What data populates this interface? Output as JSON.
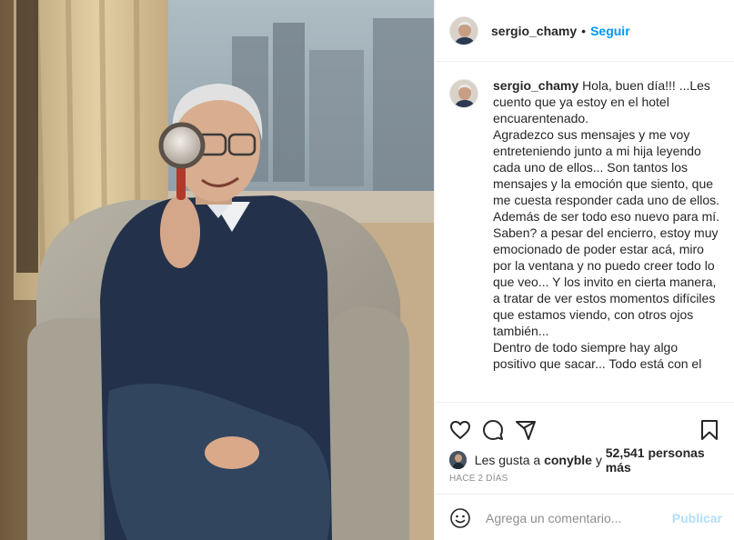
{
  "post": {
    "image_alt": "",
    "author": {
      "username": "sergio_chamy",
      "avatar_icon": "profile-avatar"
    },
    "header": {
      "dot": "•",
      "follow_label": "Seguir"
    },
    "caption": {
      "username": "sergio_chamy",
      "text": "Hola, buen día!!! ...Les cuento que ya estoy en el hotel encuarentenado.\nAgradezco sus mensajes y me voy entreteniendo junto a mi hija leyendo cada uno de ellos... Son tantos los mensajes y la emoción que siento, que me cuesta responder cada uno de ellos. Además de ser todo eso nuevo para mí.\nSaben? a pesar del encierro, estoy muy emocionado de poder estar acá, miro por la ventana y no puedo creer todo lo que veo... Y los invito en cierta manera, a tratar de ver estos momentos difíciles que estamos viendo, con otros ojos también...\nDentro de todo siempre hay algo positivo que sacar... Todo está con el"
    },
    "actions": {
      "like_icon": "heart-icon",
      "comment_icon": "comment-icon",
      "share_icon": "share-icon",
      "save_icon": "bookmark-icon"
    },
    "likes": {
      "prefix": "Les gusta a ",
      "first_user": "conyble",
      "connector": " y ",
      "count_text": "52,541 personas más"
    },
    "timestamp": "Hace 2 días",
    "add_comment": {
      "placeholder": "Agrega un comentario...",
      "publish_label": "Publicar"
    }
  },
  "colors": {
    "link_blue": "#0095f6",
    "publish_disabled": "#b2dffc",
    "muted_text": "#8e8e8e",
    "border": "#efefef"
  }
}
